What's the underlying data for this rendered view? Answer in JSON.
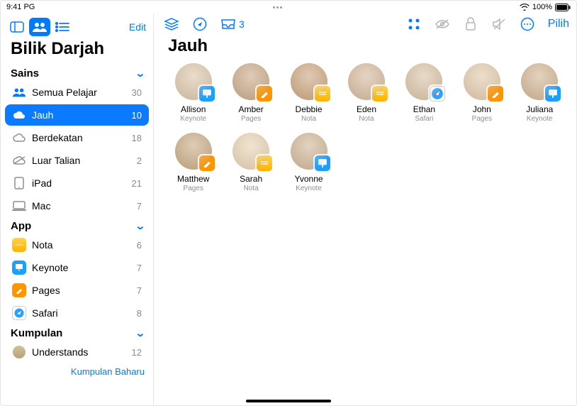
{
  "status": {
    "time": "9:41 PG",
    "battery_pct": "100%"
  },
  "sidebar": {
    "edit": "Edit",
    "title": "Bilik Darjah",
    "sections": {
      "class": {
        "header": "Sains",
        "items": [
          {
            "icon": "people-icon",
            "label": "Semua Pelajar",
            "count": "30"
          },
          {
            "icon": "cloud-icon",
            "label": "Jauh",
            "count": "10",
            "selected": true
          },
          {
            "icon": "cloud-outline-icon",
            "label": "Berdekatan",
            "count": "18"
          },
          {
            "icon": "cloud-off-icon",
            "label": "Luar Talian",
            "count": "2"
          },
          {
            "icon": "ipad-icon",
            "label": "iPad",
            "count": "21"
          },
          {
            "icon": "mac-icon",
            "label": "Mac",
            "count": "7"
          }
        ]
      },
      "apps": {
        "header": "App",
        "items": [
          {
            "icon": "nota-icon",
            "label": "Nota",
            "count": "6"
          },
          {
            "icon": "keynote-icon",
            "label": "Keynote",
            "count": "7"
          },
          {
            "icon": "pages-icon",
            "label": "Pages",
            "count": "7"
          },
          {
            "icon": "safari-icon",
            "label": "Safari",
            "count": "8"
          }
        ]
      },
      "groups": {
        "header": "Kumpulan",
        "items": [
          {
            "icon": "group-avatar-icon",
            "label": "Understands",
            "count": "12"
          }
        ],
        "new": "Kumpulan Baharu"
      }
    }
  },
  "toolbar": {
    "inbox_badge": "3",
    "select": "Pilih"
  },
  "main": {
    "title": "Jauh",
    "students": [
      {
        "name": "Allison",
        "app": "Keynote",
        "badge": "keynote"
      },
      {
        "name": "Amber",
        "app": "Pages",
        "badge": "pages"
      },
      {
        "name": "Debbie",
        "app": "Nota",
        "badge": "nota"
      },
      {
        "name": "Eden",
        "app": "Nota",
        "badge": "nota"
      },
      {
        "name": "Ethan",
        "app": "Safari",
        "badge": "safari"
      },
      {
        "name": "John",
        "app": "Pages",
        "badge": "pages"
      },
      {
        "name": "Juliana",
        "app": "Keynote",
        "badge": "keynote"
      },
      {
        "name": "Matthew",
        "app": "Pages",
        "badge": "pages"
      },
      {
        "name": "Sarah",
        "app": "Nota",
        "badge": "nota"
      },
      {
        "name": "Yvonne",
        "app": "Keynote",
        "badge": "keynote"
      }
    ]
  },
  "avatar_tints": [
    "#d9c5a8",
    "#c9a887",
    "#caa57f",
    "#d4b79b",
    "#d7c1a3",
    "#e0c8a9",
    "#d0b492",
    "#c7aa84",
    "#e6d1b2",
    "#cfb596"
  ]
}
